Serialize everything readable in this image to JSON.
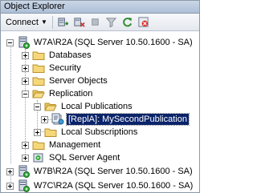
{
  "window": {
    "title": "Object Explorer"
  },
  "toolbar": {
    "connect_label": "Connect",
    "icons": [
      "connect-server-icon",
      "disconnect-icon",
      "stop-icon",
      "filter-icon",
      "refresh-icon",
      "cancel-icon"
    ]
  },
  "tree": {
    "server1": "W7A\\R2A (SQL Server 10.50.1600 - SA)",
    "databases": "Databases",
    "security": "Security",
    "server_objects": "Server Objects",
    "replication": "Replication",
    "local_publications": "Local Publications",
    "publication": "[ReplA]: MySecondPublication",
    "local_subscriptions": "Local Subscriptions",
    "management": "Management",
    "agent": "SQL Server Agent",
    "server2": "W7B\\R2A (SQL Server 10.50.1600 - SA)",
    "server3": "W7C\\R2A (SQL Server 10.50.1600 - SA)"
  },
  "colors": {
    "selection": "#0a246a",
    "folder": "#f5d77a"
  }
}
